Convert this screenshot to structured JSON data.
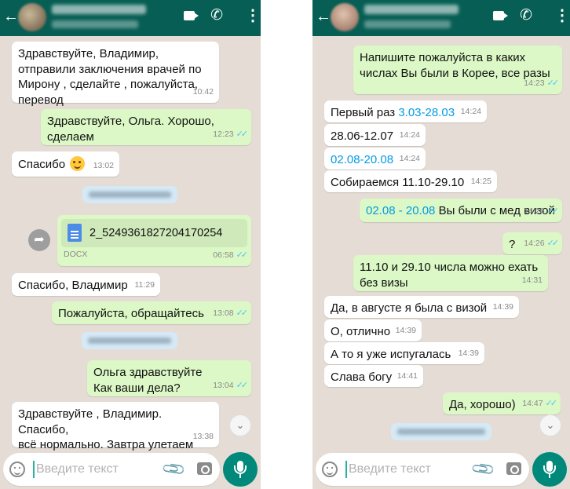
{
  "input_placeholder": "Введите текст",
  "colors": {
    "header": "#075e54",
    "outgoing": "#dcf8c6",
    "incoming": "#ffffff",
    "background": "#e5ddd5",
    "accent": "#00897b",
    "read_ticks": "#4fc3f7"
  },
  "icons": [
    "back-arrow-icon",
    "video-call-icon",
    "phone-icon",
    "more-menu-icon",
    "emoji-icon",
    "attach-icon",
    "camera-icon",
    "mic-icon",
    "forward-icon",
    "scroll-down-icon",
    "document-icon",
    "read-receipt-icon"
  ],
  "left_chat": {
    "messages": [
      {
        "dir": "in",
        "text": [
          "Здравствуйте, Владимир,",
          "отправили заключения врачей по",
          "Мирону , сделайте , пожалуйста,",
          "перевод"
        ],
        "time": "10:42"
      },
      {
        "dir": "out",
        "text": [
          "Здравствуйте, Ольга. Хорошо,",
          "сделаем"
        ],
        "time": "12:23"
      },
      {
        "dir": "in",
        "text": [
          "Спасибо"
        ],
        "time": "13:02"
      },
      {
        "dir": "out",
        "file": {
          "name": "2_5249361827204170254",
          "type": "DOCX"
        },
        "time": "06:58"
      },
      {
        "dir": "in",
        "text": [
          "Спасибо, Владимир"
        ],
        "time": "11:29"
      },
      {
        "dir": "out",
        "text": [
          "Пожалуйста, обращайтесь"
        ],
        "time": "13:08"
      },
      {
        "dir": "out",
        "text": [
          "Ольга здравствуйте",
          "Как ваши дела?"
        ],
        "time": "13:04"
      },
      {
        "dir": "in",
        "text": [
          "Здравствуйте , Владимир. Спасибо,",
          "всё нормально. Завтра улетаем"
        ],
        "time": "13:38"
      }
    ]
  },
  "right_chat": {
    "messages": [
      {
        "dir": "out",
        "text": [
          "Напишите пожалуйста в каких",
          "числах Вы были в Корее, все разы"
        ],
        "time": "14:23"
      },
      {
        "dir": "in",
        "prefix": "Первый раз ",
        "link": "3.03-28.03",
        "time": "14:24"
      },
      {
        "dir": "in",
        "text": [
          "28.06-12.07"
        ],
        "time": "14:24"
      },
      {
        "dir": "in",
        "link": "02.08-20.08",
        "time": "14:24"
      },
      {
        "dir": "in",
        "text": [
          "Собираемся 11.10-29.10"
        ],
        "time": "14:25"
      },
      {
        "dir": "out",
        "link": "02.08 - 20.08",
        "suffix": " Вы были с мед визой",
        "time": "14:26"
      },
      {
        "dir": "out",
        "text": [
          "?"
        ],
        "time": "14:26"
      },
      {
        "dir": "out",
        "text": [
          "11.10 и 29.10 числа можно ехать",
          "без визы"
        ],
        "time": "14:31"
      },
      {
        "dir": "in",
        "text": [
          "Да, в августе я была с визой"
        ],
        "time": "14:39"
      },
      {
        "dir": "in",
        "text": [
          "О, отлично"
        ],
        "time": "14:39"
      },
      {
        "dir": "in",
        "text": [
          "А то я уже испугалась"
        ],
        "time": "14:39"
      },
      {
        "dir": "in",
        "text": [
          "Слава богу"
        ],
        "time": "14:41"
      },
      {
        "dir": "out",
        "text": [
          "Да, хорошо)"
        ],
        "time": "14:47"
      }
    ]
  }
}
